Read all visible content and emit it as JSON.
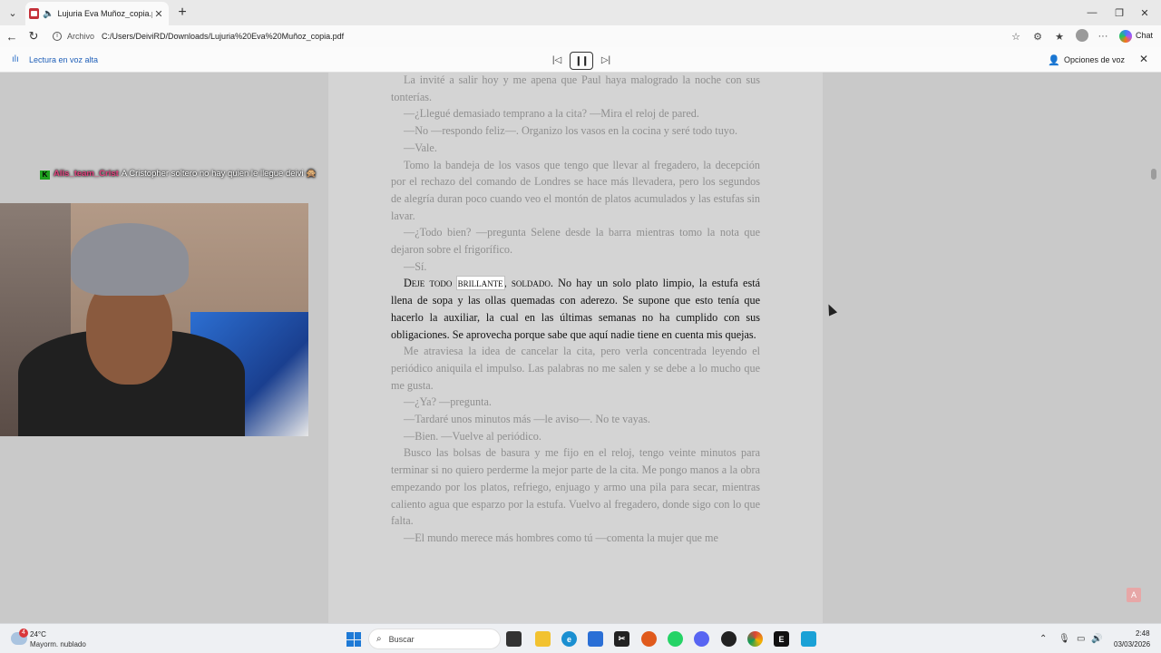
{
  "browser": {
    "tab_title": "Lujuria Eva Muñoz_copia.pdf",
    "address_label": "Archivo",
    "url": "C:/Users/DeiviRD/Downloads/Lujuria%20Eva%20Muñoz_copia.pdf",
    "chat_label": "Chat"
  },
  "readaloud": {
    "label": "Lectura en voz alta",
    "voice_options": "Opciones de voz"
  },
  "overlay": {
    "badge": "K",
    "user": "Alis_team_Crist",
    "message": "A Cristopher soltero no hay quien le llegue deivi 🙊"
  },
  "document": {
    "paragraphs": [
      "La invité a salir hoy y me apena que Paul haya malogrado la noche con sus tonterías.",
      "—¿Llegué demasiado temprano a la cita? —Mira el reloj de pared.",
      "—No —respondo feliz—. Organizo los vasos en la cocina y seré todo tuyo.",
      "—Vale.",
      "Tomo la bandeja de los vasos que tengo que llevar al fregadero, la decepción por el rechazo del comando de Londres se hace más llevadera, pero los segundos de alegría duran poco cuando veo el montón de platos acumulados y las estufas sin lavar.",
      "—¿Todo bien? —pregunta Selene desde la barra mientras tomo la nota que dejaron sobre el frigorífico.",
      "—Sí."
    ],
    "current": {
      "lead_before": "Deje todo",
      "highlight": "brillante",
      "lead_after": ", soldado.",
      "rest": " No hay un solo plato limpio, la estufa está llena de sopa y las ollas quemadas con aderezo. Se supone que esto tenía que hacerlo la auxiliar, la cual en las últimas semanas no ha cumplido con sus obligaciones. Se aprovecha porque sabe que aquí nadie tiene en cuenta mis quejas."
    },
    "paragraphs_after": [
      "Me atraviesa la idea de cancelar la cita, pero verla concentrada leyendo el periódico aniquila el impulso. Las palabras no me salen y se debe a lo mucho que me gusta.",
      "—¿Ya? —pregunta.",
      "—Tardaré unos minutos más —le aviso—. No te vayas.",
      "—Bien. —Vuelve al periódico.",
      "Busco las bolsas de basura y me fijo en el reloj, tengo veinte minutos para terminar si no quiero perderme la mejor parte de la cita. Me pongo manos a la obra empezando por los platos, refriego, enjuago y armo una pila para secar, mientras caliento agua que esparzo por la estufa. Vuelvo al fregadero, donde sigo con lo que falta.",
      "—El mundo merece más hombres como tú —comenta la mujer que me"
    ]
  },
  "taskbar": {
    "weather_badge": "4",
    "temperature": "24°C",
    "weather": "Mayorm. nublado",
    "search_placeholder": "Buscar",
    "time": "2:48",
    "date": "03/03/2026"
  },
  "colors": {
    "accent": "#1f5fb8",
    "chat_user": "#e0437e",
    "page_bg": "#d4d4d4"
  }
}
